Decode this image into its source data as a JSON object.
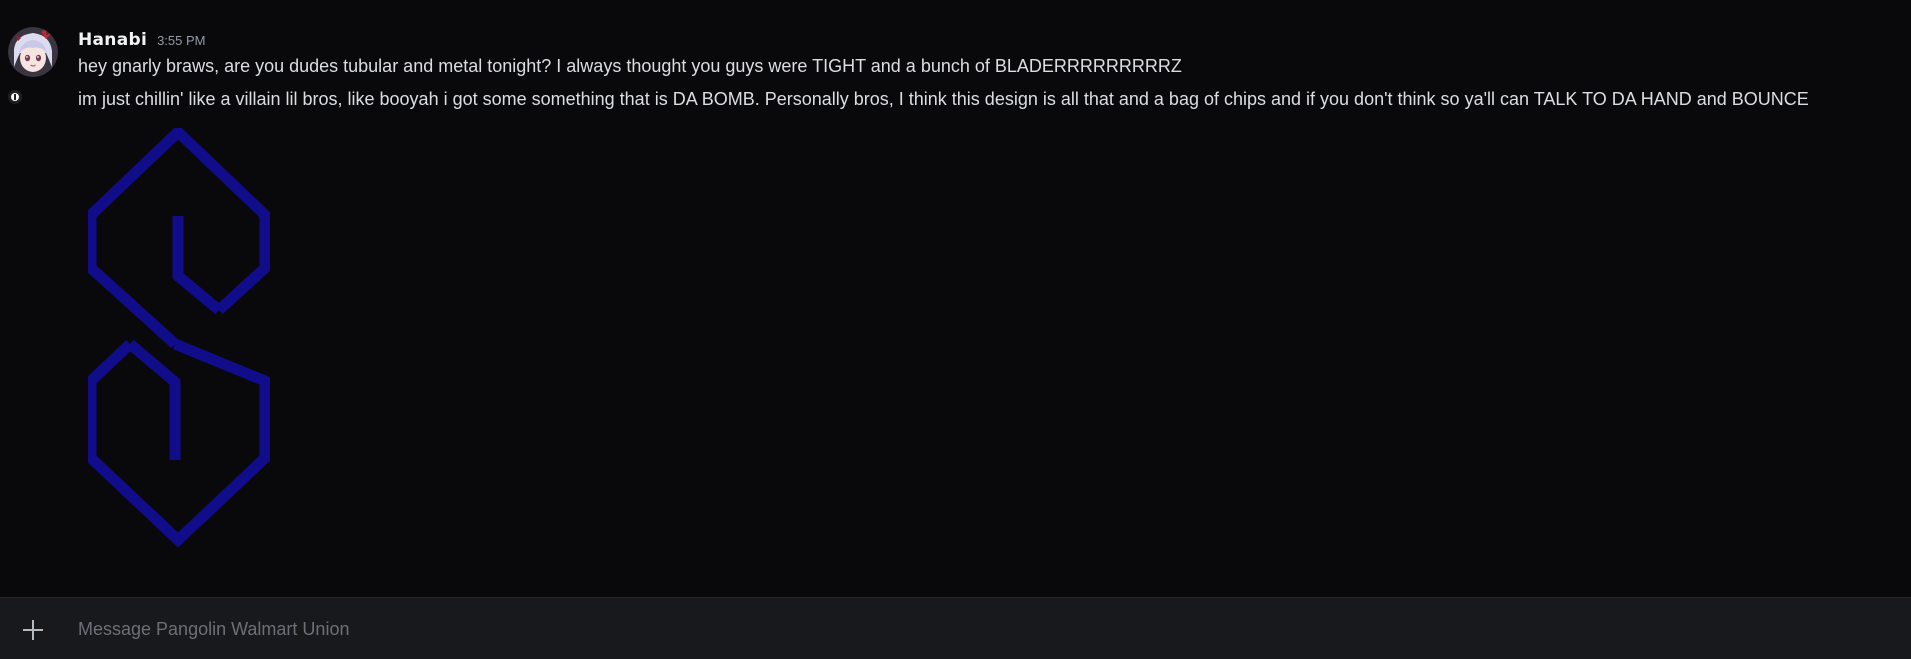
{
  "message": {
    "username": "Hanabi",
    "timestamp": "3:55 PM",
    "lines": [
      "hey gnarly braws, are you dudes tubular and metal tonight? I always thought you guys were TIGHT and a bunch of BLADERRRRRRRRRZ",
      "im just chillin' like a villain lil bros, like booyah i got some something that is DA BOMB. Personally bros, I think this design is all that and a bag of chips and if you don't think so ya'll can TALK TO DA HAND and BOUNCE"
    ],
    "avatar_icon": "anime-character-avatar",
    "attachment": {
      "icon": "navy-s-logo",
      "color": "#100c8a"
    }
  },
  "composer": {
    "add_icon": "plus-icon",
    "placeholder": "Message Pangolin Walmart Union"
  },
  "colors": {
    "background": "#09090b",
    "composer_background": "#18191c",
    "text": "#dbdee1",
    "muted": "#949ba4",
    "logo": "#100c8a"
  }
}
